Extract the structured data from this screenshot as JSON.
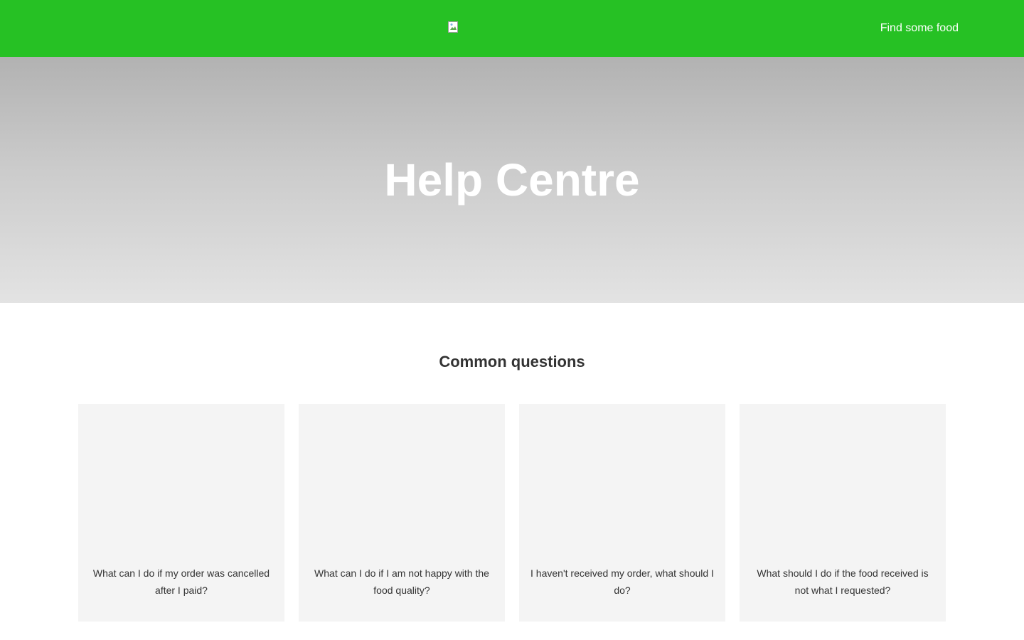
{
  "header": {
    "logo_icon": "broken-image-icon",
    "nav_link": "Find some food",
    "color": "#26c124"
  },
  "hero": {
    "title": "Help Centre"
  },
  "questions": {
    "title": "Common questions",
    "items": [
      {
        "label": "What can I do if my order was cancelled after I paid?"
      },
      {
        "label": "What can I do if I am not happy with the food quality?"
      },
      {
        "label": "I haven't received my order, what should I do?"
      },
      {
        "label": "What should I do if the food received is not what I requested?"
      }
    ]
  }
}
